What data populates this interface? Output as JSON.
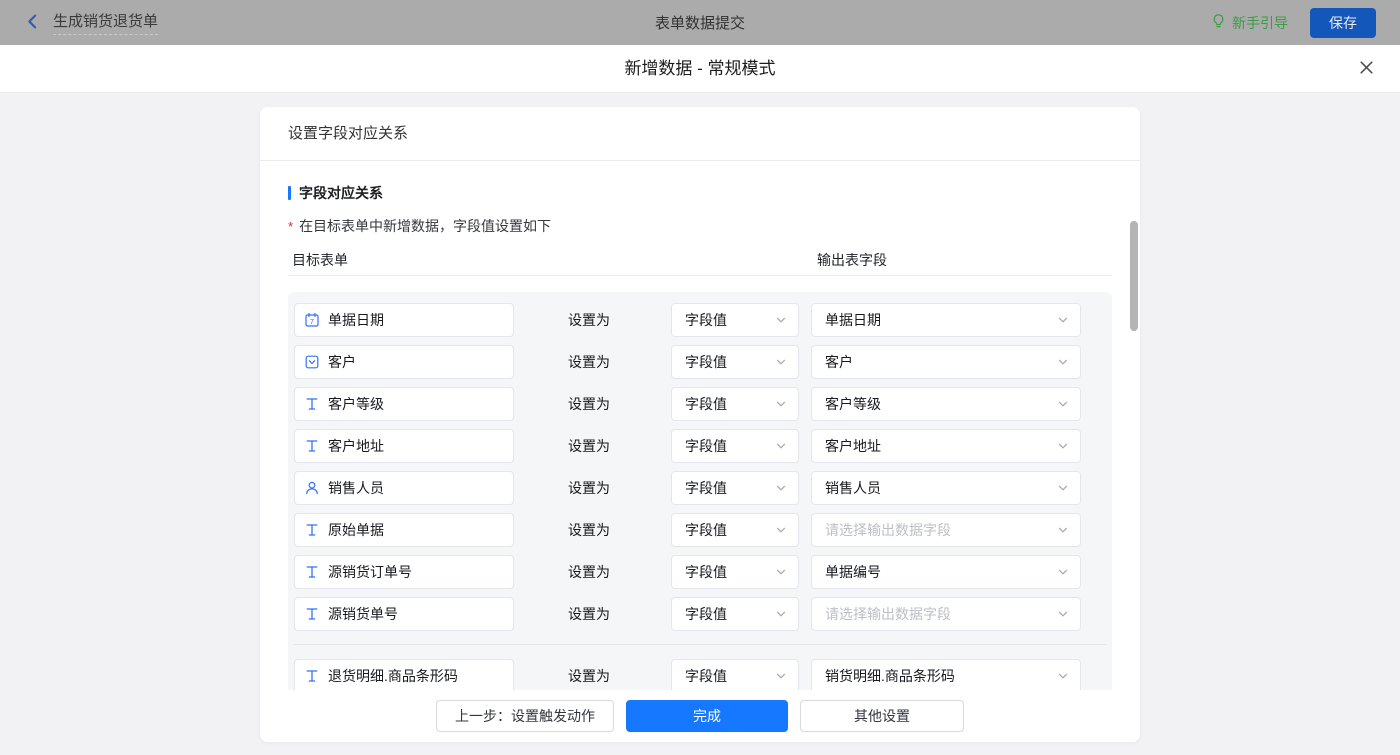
{
  "topbar": {
    "back_label": "生成销货退货单",
    "title": "表单数据提交",
    "guide_label": "新手引导",
    "save_label": "保存"
  },
  "modal": {
    "title": "新增数据 - 常规模式",
    "panel_title": "设置字段对应关系",
    "section_title": "字段对应关系",
    "required_mark": "*",
    "note": "在目标表单中新增数据，字段值设置如下",
    "columns": {
      "target": "目标表单",
      "output": "输出表字段"
    },
    "set_as_label": "设置为",
    "output_placeholder": "请选择输出数据字段",
    "rows": [
      {
        "field": "单据日期",
        "icon": "calendar",
        "mode": "字段值",
        "output": "单据日期",
        "placeholder": false
      },
      {
        "field": "客户",
        "icon": "select",
        "mode": "字段值",
        "output": "客户",
        "placeholder": false
      },
      {
        "field": "客户等级",
        "icon": "text",
        "mode": "字段值",
        "output": "客户等级",
        "placeholder": false
      },
      {
        "field": "客户地址",
        "icon": "text",
        "mode": "字段值",
        "output": "客户地址",
        "placeholder": false
      },
      {
        "field": "销售人员",
        "icon": "user",
        "mode": "字段值",
        "output": "销售人员",
        "placeholder": false
      },
      {
        "field": "原始单据",
        "icon": "text",
        "mode": "字段值",
        "output": "",
        "placeholder": true
      },
      {
        "field": "源销货订单号",
        "icon": "text",
        "mode": "字段值",
        "output": "单据编号",
        "placeholder": false
      },
      {
        "field": "源销货单号",
        "icon": "text",
        "mode": "字段值",
        "output": "",
        "placeholder": true
      },
      {
        "field": "退货明细.商品条形码",
        "icon": "text",
        "mode": "字段值",
        "output": "销货明细.商品条形码",
        "placeholder": false,
        "divider_before": true
      }
    ]
  },
  "footer": {
    "prev_label": "上一步：设置触发动作",
    "done_label": "完成",
    "other_label": "其他设置"
  },
  "colors": {
    "accent_blue": "#1677ff",
    "save_blue": "#1457bb",
    "guide_green": "#3a9d44",
    "required_red": "#f5222d",
    "icon_blue": "#3370ff"
  }
}
